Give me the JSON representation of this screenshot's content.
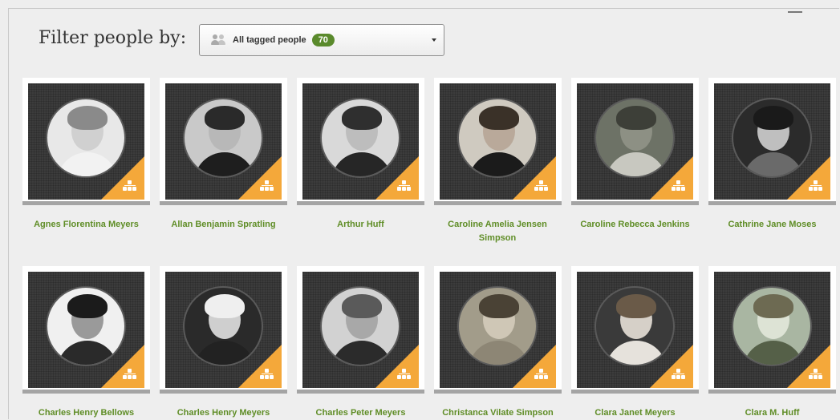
{
  "filter": {
    "label": "Filter people by:",
    "selected_option": "All tagged people",
    "count": "70"
  },
  "people": [
    {
      "name": "Agnes Florentina Meyers"
    },
    {
      "name": "Allan Benjamin Spratling"
    },
    {
      "name": "Arthur Huff"
    },
    {
      "name": "Caroline Amelia Jensen Simpson"
    },
    {
      "name": "Caroline Rebecca Jenkins"
    },
    {
      "name": "Cathrine Jane Moses"
    },
    {
      "name": "Charles Henry Bellows"
    },
    {
      "name": "Charles Henry Meyers"
    },
    {
      "name": "Charles Peter Meyers"
    },
    {
      "name": "Christanca Vilate Simpson"
    },
    {
      "name": "Clara Janet Meyers"
    },
    {
      "name": "Clara M. Huff"
    }
  ],
  "colors": {
    "accent_green": "#5f8d26",
    "badge_green": "#5a8a2c",
    "corner_orange": "#f4a83a"
  },
  "icons": {
    "filter": "people-icon",
    "dropdown": "chevron-down-icon",
    "card_badge": "family-tree-icon"
  }
}
